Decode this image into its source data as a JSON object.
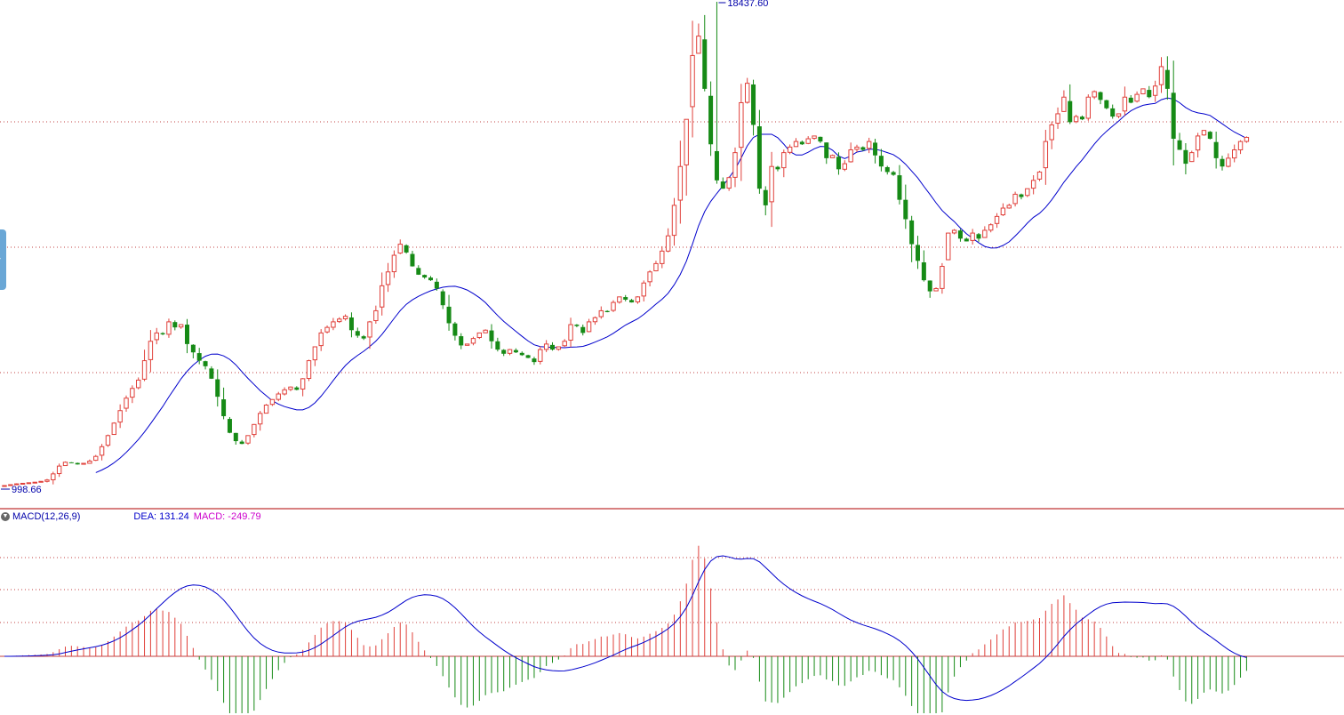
{
  "colors": {
    "up": "#e0403a",
    "down": "#168a16",
    "ma": "#0000cc",
    "dea": "#0000cc",
    "macd_label": "#cc00cc",
    "grid": "#c04040",
    "separator": "#b00000"
  },
  "main_panel": {
    "high_label": "18437.60",
    "low_label": "998.66"
  },
  "macd_panel": {
    "indicator_label": "MACD(12,26,9)",
    "dea_label": "DEA: 131.24",
    "macd_label": "MACD: -249.79"
  },
  "icons": {
    "collapse": "circle-chevron-down-icon",
    "side_tab": "chevron-right-icon"
  },
  "chart_data": [
    {
      "type": "candlestick",
      "overlay": "moving average line",
      "price_anchor": {
        "high": 18437.6,
        "low": 998.66
      },
      "closes": [
        998.66,
        1030,
        1060,
        1080,
        1100,
        1120,
        1150,
        1200,
        1420,
        1700,
        1840,
        1820,
        1760,
        1800,
        1880,
        2050,
        2400,
        2800,
        3250,
        3700,
        4150,
        4500,
        4800,
        5500,
        6200,
        6500,
        6450,
        6900,
        6700,
        6800,
        6100,
        5800,
        5500,
        5300,
        4850,
        4200,
        3500,
        2900,
        2600,
        2500,
        2800,
        3200,
        3600,
        3900,
        4100,
        4300,
        4450,
        4550,
        4450,
        4850,
        5500,
        6000,
        6500,
        6700,
        6900,
        7000,
        7100,
        6600,
        6400,
        6300,
        6900,
        7300,
        8200,
        8700,
        9300,
        9700,
        9400,
        8900,
        8600,
        8500,
        8400,
        8100,
        7500,
        6850,
        6400,
        6050,
        6100,
        6300,
        6500,
        6600,
        6200,
        5900,
        5750,
        5900,
        5800,
        5700,
        5600,
        5450,
        5900,
        6100,
        5900,
        6000,
        6200,
        6800,
        6750,
        6500,
        6900,
        7050,
        7300,
        7250,
        7600,
        7800,
        7700,
        7600,
        7800,
        8300,
        8700,
        9000,
        9450,
        10000,
        11100,
        12500,
        14200,
        16500,
        17200,
        15300,
        13300,
        12000,
        11700,
        12100,
        13000,
        14800,
        15500,
        14000,
        11700,
        11100,
        12500,
        12400,
        13000,
        13200,
        13400,
        13300,
        13500,
        13600,
        13400,
        12800,
        12900,
        12400,
        12600,
        13100,
        13200,
        13100,
        13400,
        12900,
        12500,
        12300,
        12200,
        11300,
        10600,
        9700,
        9100,
        8400,
        8000,
        8100,
        8900,
        10100,
        10200,
        9900,
        9800,
        10100,
        9900,
        10200,
        10400,
        10700,
        11000,
        11100,
        11500,
        11400,
        11700,
        12000,
        12300,
        13400,
        14000,
        14400,
        15000,
        14100,
        14300,
        14200,
        15000,
        15200,
        14900,
        14600,
        14300,
        14400,
        15000,
        14800,
        15100,
        15300,
        15000,
        15400,
        16100,
        15300,
        13500,
        13100,
        12600,
        13000,
        13600,
        13800,
        13500,
        12800,
        12500,
        12800,
        13100,
        13400,
        13550
      ],
      "ma_start_index": 15
    },
    {
      "type": "macd",
      "parameters": [
        12,
        26,
        9
      ],
      "series": [
        {
          "name": "DEA",
          "last_value": 131.24
        },
        {
          "name": "MACD",
          "last_value": -249.79
        }
      ]
    }
  ]
}
